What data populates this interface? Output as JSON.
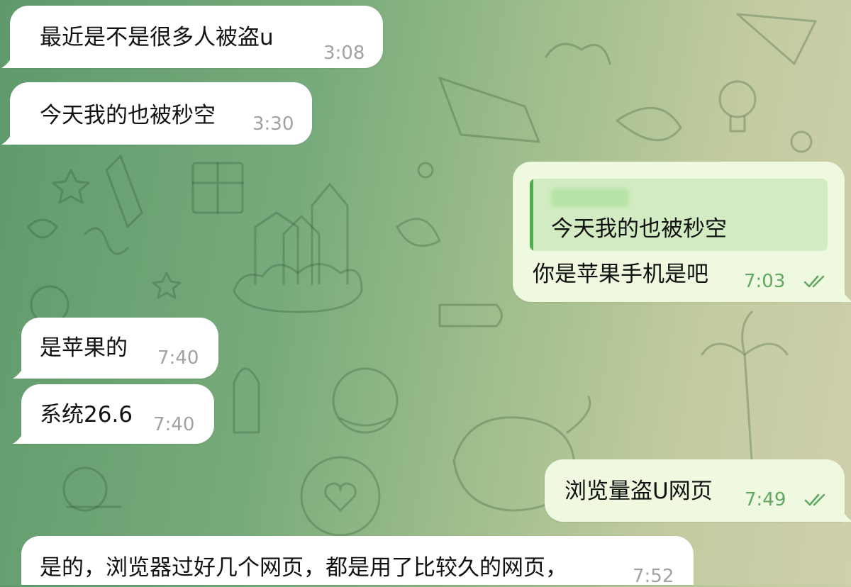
{
  "messages": [
    {
      "id": "m1",
      "direction": "incoming",
      "text": "最近是不是很多人被盗u",
      "time": "3:08"
    },
    {
      "id": "m2",
      "direction": "incoming",
      "text": "今天我的也被秒空",
      "time": "3:30"
    },
    {
      "id": "m3",
      "direction": "outgoing",
      "text": "你是苹果手机是吧",
      "time": "7:03",
      "reply_to": {
        "sender": "",
        "text": "今天我的也被秒空"
      },
      "read": true
    },
    {
      "id": "m4",
      "direction": "incoming",
      "text": "是苹果的",
      "time": "7:40"
    },
    {
      "id": "m5",
      "direction": "incoming",
      "text": "系统26.6",
      "time": "7:40"
    },
    {
      "id": "m6",
      "direction": "outgoing",
      "text": "浏览量盗U网页",
      "time": "7:49",
      "read": true
    },
    {
      "id": "m7",
      "direction": "incoming",
      "text": "是的，浏览器过好几个网页，都是用了比较久的网页，",
      "time": "7:52"
    }
  ],
  "icons": {
    "read_receipt": "double-check-icon"
  },
  "colors": {
    "incoming_bubble": "#ffffff",
    "outgoing_bubble": "#eef9df",
    "outgoing_time": "#63a863",
    "incoming_time": "#a2a2a2",
    "reply_bar": "#4fae4e"
  }
}
